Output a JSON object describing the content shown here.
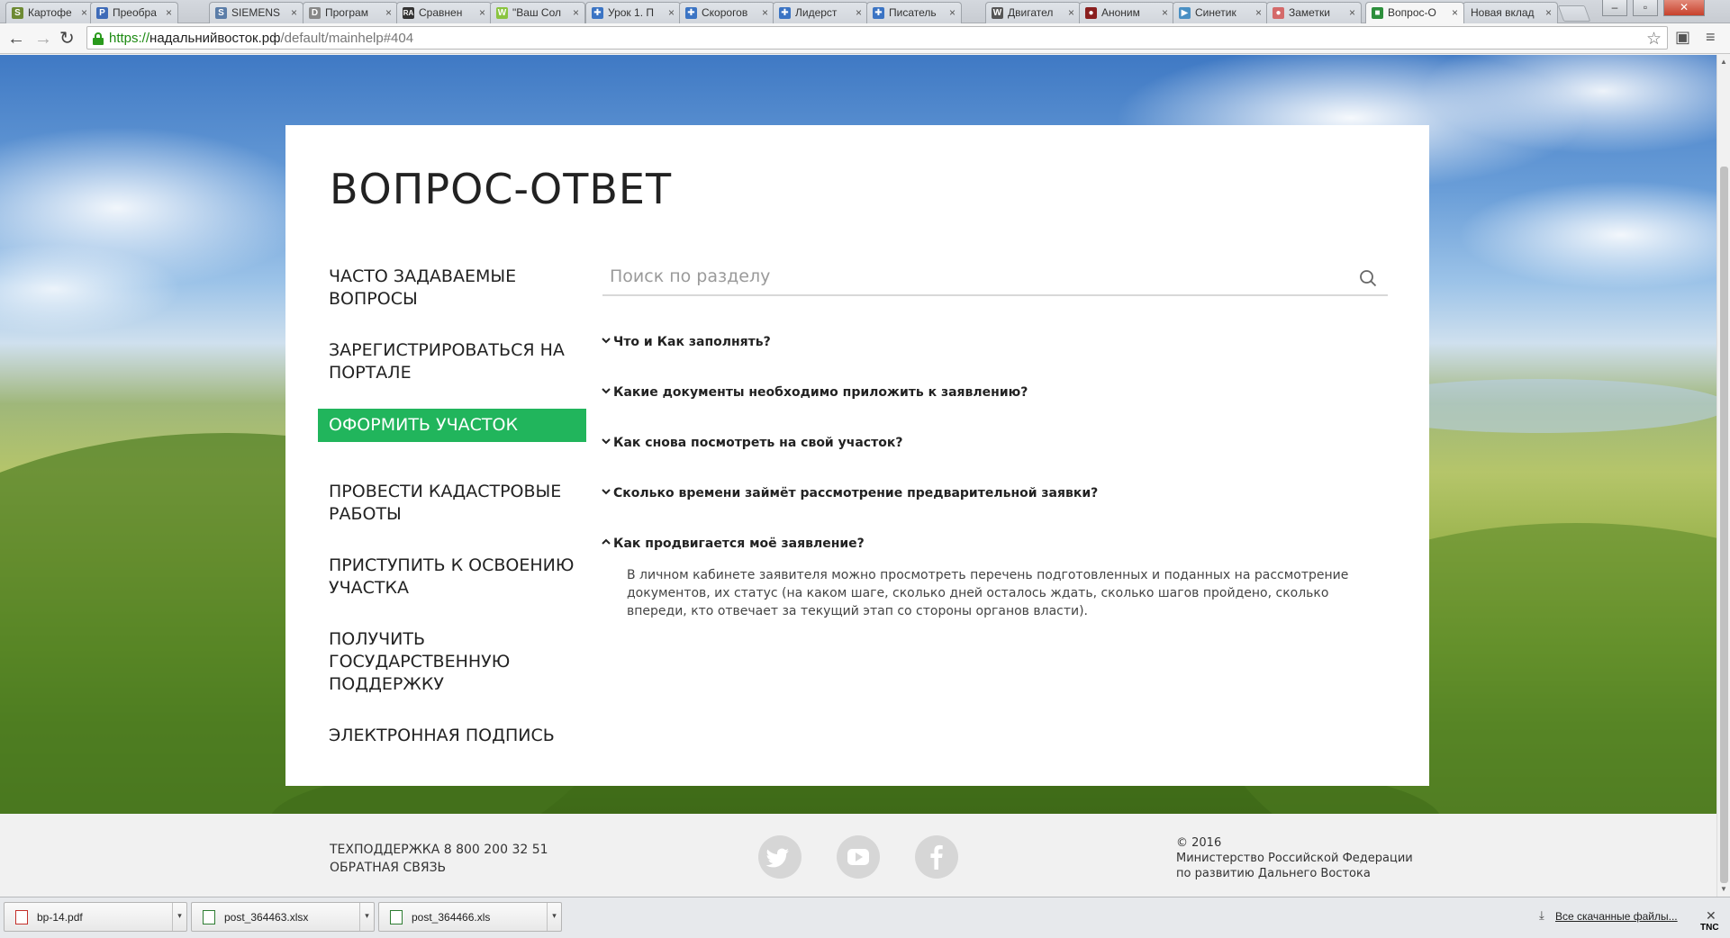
{
  "browser": {
    "tabs": [
      {
        "label": "Картофе",
        "favicon": "S",
        "color": "#6d8a33"
      },
      {
        "label": "Преобра",
        "favicon": "P",
        "color": "#3e6bb8"
      },
      {
        "label": "SIEMENS",
        "favicon": "S",
        "color": "#5b7da8"
      },
      {
        "label": "Програм",
        "favicon": "D",
        "color": "#888888"
      },
      {
        "label": "Сравнен",
        "favicon": "RA",
        "color": "#333333"
      },
      {
        "label": "\"Ваш Сол",
        "favicon": "W",
        "color": "#8ac43f"
      },
      {
        "label": "Урок 1. П",
        "favicon": "✚",
        "color": "#3b74c4"
      },
      {
        "label": "Скорогов",
        "favicon": "✚",
        "color": "#3b74c4"
      },
      {
        "label": "Лидерст",
        "favicon": "✚",
        "color": "#3b74c4"
      },
      {
        "label": "Писатель",
        "favicon": "✚",
        "color": "#3b74c4"
      },
      {
        "label": "Двигател",
        "favicon": "W",
        "color": "#555555"
      },
      {
        "label": "Аноним",
        "favicon": "●",
        "color": "#8a1f1f"
      },
      {
        "label": "Синетик",
        "favicon": "▶",
        "color": "#4a90c4"
      },
      {
        "label": "Заметки",
        "favicon": "●",
        "color": "#d46a6a"
      },
      {
        "label": "Вопрос-О",
        "favicon": "■",
        "color": "#2d8f3c",
        "active": true
      },
      {
        "label": "Новая вклад",
        "favicon": "",
        "color": "#cccccc"
      }
    ],
    "url_scheme": "https://",
    "url_host": "надальнийвосток.рф",
    "url_path": "/default/mainhelp#404"
  },
  "page": {
    "title": "ВОПРОС-ОТВЕТ",
    "menu": [
      {
        "label": "ЧАСТО ЗАДАВАЕМЫЕ ВОПРОСЫ"
      },
      {
        "label": "ЗАРЕГИСТРИРОВАТЬСЯ НА ПОРТАЛЕ"
      },
      {
        "label": "ОФОРМИТЬ УЧАСТОК",
        "active": true
      },
      {
        "label": "ПРОВЕСТИ КАДАСТРОВЫЕ РАБОТЫ"
      },
      {
        "label": "ПРИСТУПИТЬ К ОСВОЕНИЮ УЧАСТКА"
      },
      {
        "label": "ПОЛУЧИТЬ ГОСУДАРСТВЕННУЮ ПОДДЕРЖКУ"
      },
      {
        "label": "ЭЛЕКТРОННАЯ ПОДПИСЬ"
      }
    ],
    "search": {
      "placeholder": "Поиск по разделу",
      "value": ""
    },
    "faq": [
      {
        "question": "Что и Как заполнять?",
        "expanded": false
      },
      {
        "question": "Какие документы необходимо приложить к заявлению?",
        "expanded": false
      },
      {
        "question": "Как снова посмотреть на свой участок?",
        "expanded": false
      },
      {
        "question": "Сколько времени займёт рассмотрение предварительной заявки?",
        "expanded": false
      },
      {
        "question": "Как продвигается моё заявление?",
        "expanded": true,
        "answer": "В личном кабинете заявителя можно просмотреть перечень подготовленных и поданных на рассмотрение документов, их статус (на каком шаге, сколько дней осталось ждать, сколько шагов пройдено, сколько впереди, кто отвечает за текущий этап со стороны органов власти)."
      }
    ],
    "accent_color": "#21b55c"
  },
  "footer": {
    "support": "ТЕХПОДДЕРЖКА 8 800 200 32 51",
    "feedback": "ОБРАТНАЯ СВЯЗЬ",
    "social": [
      "twitter-icon",
      "youtube-icon",
      "facebook-icon"
    ],
    "copyright_year": "© 2016",
    "org_line1": "Министерство Российской Федерации",
    "org_line2": "по развитию Дальнего Востока"
  },
  "downloads": {
    "items": [
      {
        "name": "bp-14.pdf",
        "type": "pdf"
      },
      {
        "name": "post_364463.xlsx",
        "type": "xls"
      },
      {
        "name": "post_364466.xls",
        "type": "xls"
      }
    ],
    "show_all": "Все скачанные файлы...",
    "watermark": "TNC"
  }
}
